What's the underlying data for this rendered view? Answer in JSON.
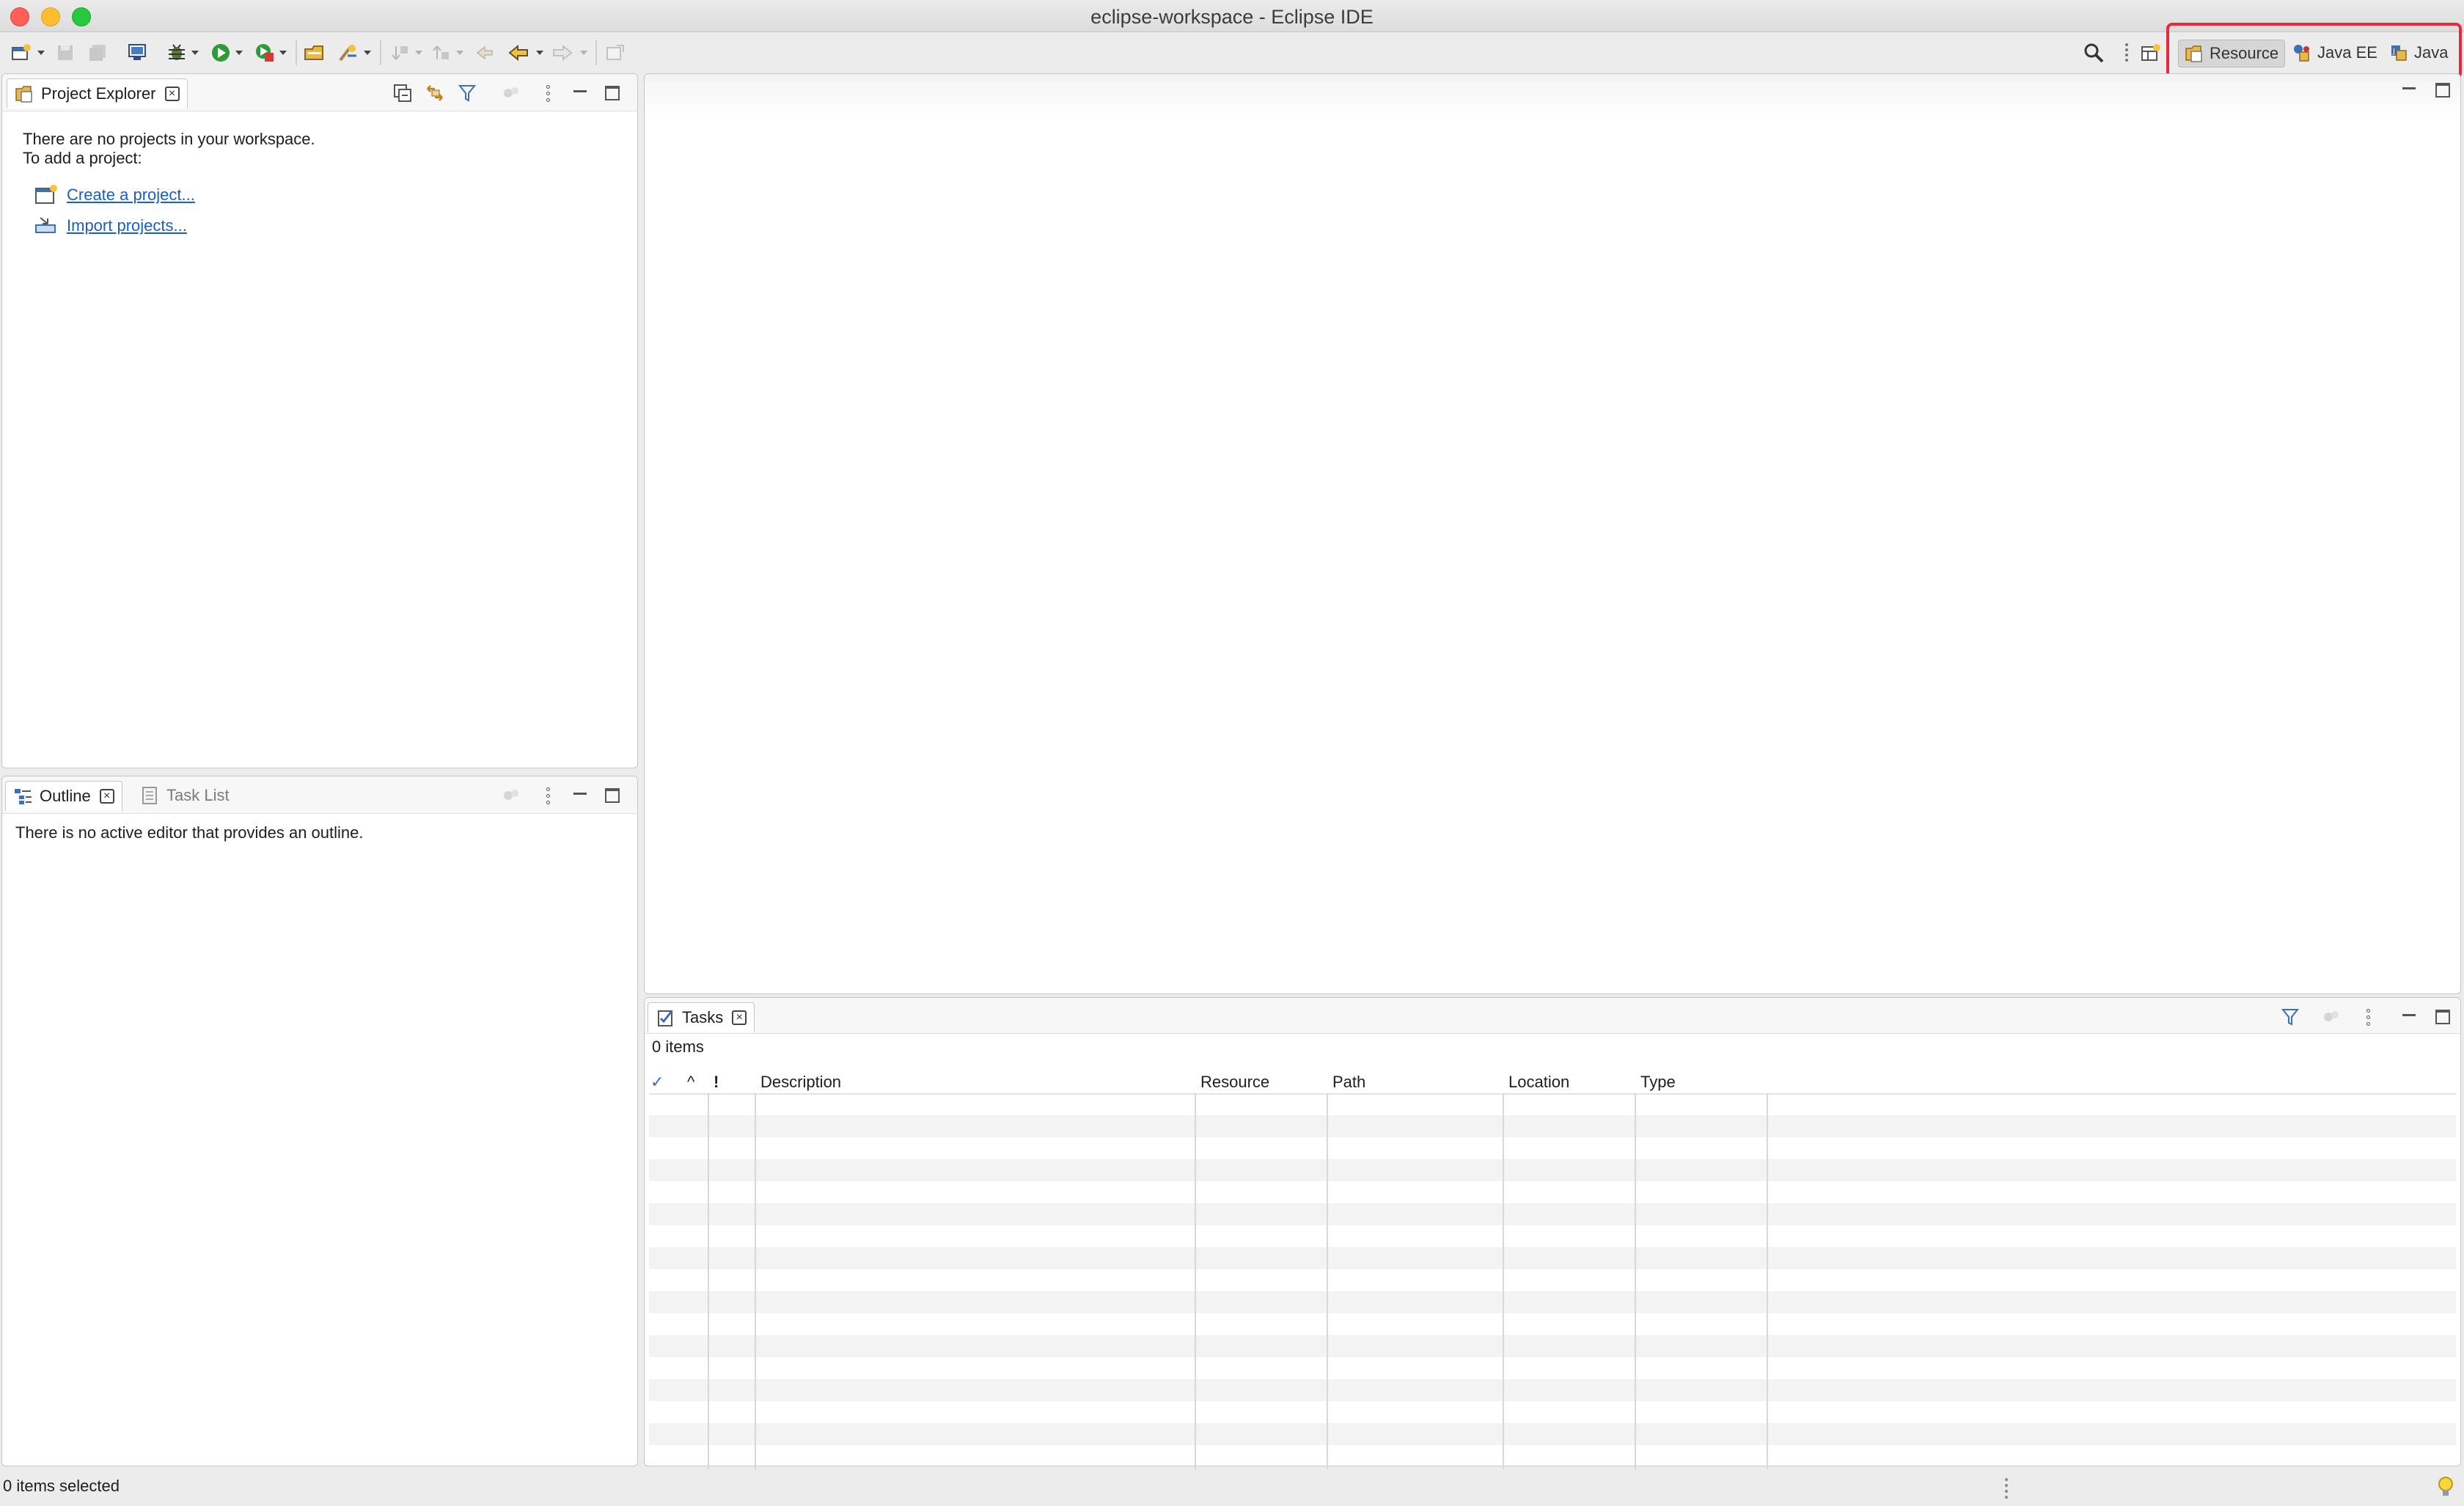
{
  "window": {
    "title": "eclipse-workspace - Eclipse IDE"
  },
  "toolbar": {
    "icons": [
      "new-wizard-icon",
      "save-icon",
      "save-all-icon",
      "open-console-icon",
      "debug-icon",
      "run-icon",
      "run-coverage-icon",
      "open-type-icon",
      "search-task-icon",
      "next-annotation-icon",
      "prev-annotation-icon",
      "last-edit-icon",
      "back-icon",
      "forward-icon",
      "pin-editor-icon"
    ],
    "search_icon": "search-icon"
  },
  "perspectives": {
    "items": [
      {
        "label": "Resource",
        "icon": "resource-perspective-icon",
        "active": true
      },
      {
        "label": "Java EE",
        "icon": "javaee-perspective-icon",
        "active": false
      },
      {
        "label": "Java",
        "icon": "java-perspective-icon",
        "active": false
      }
    ],
    "highlight_color": "#e8283b"
  },
  "project_explorer": {
    "tab_label": "Project Explorer",
    "empty_line1": "There are no projects in your workspace.",
    "empty_line2": "To add a project:",
    "create_link": "Create a project...",
    "import_link": "Import projects..."
  },
  "outline": {
    "tab_outline": "Outline",
    "tab_tasklist": "Task List",
    "empty_message": "There is no active editor that provides an outline."
  },
  "tasks": {
    "tab_label": "Tasks",
    "count_text": "0 items",
    "columns": [
      "✓",
      "^",
      "!",
      "Description",
      "Resource",
      "Path",
      "Location",
      "Type"
    ]
  },
  "status": {
    "text": "0 items selected"
  },
  "colors": {
    "link": "#1a5ec7",
    "accent_highlight": "#e8283b",
    "traffic_close": "#fe5f57",
    "traffic_min": "#febc2e",
    "traffic_max": "#28c840"
  }
}
